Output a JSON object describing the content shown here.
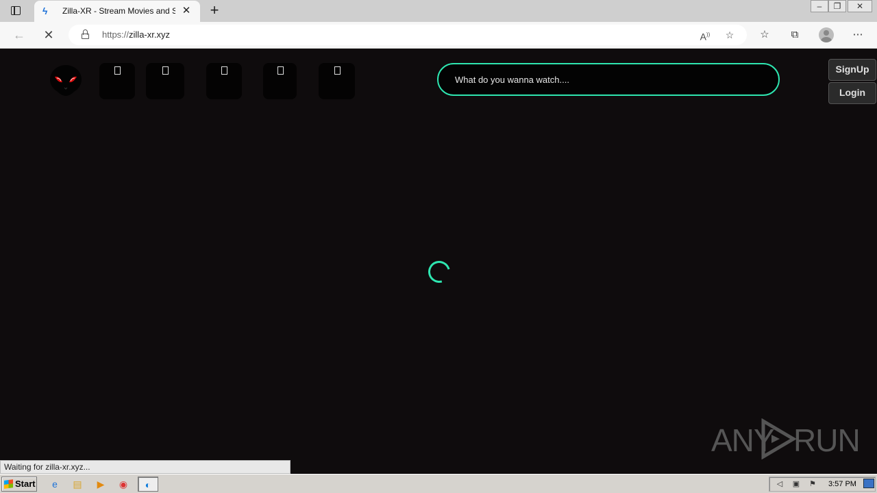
{
  "browser": {
    "tab_title": "Zilla-XR - Stream Movies and Se",
    "tab_favicon": "bird-favicon-icon",
    "close_tab": "✕",
    "new_tab": "+",
    "url_protocol": "https://",
    "url_host": "zilla-xr.xyz",
    "status_text": "Waiting for zilla-xr.xyz..."
  },
  "page": {
    "search_placeholder": "What do you wanna watch....",
    "signup_label": "SignUp",
    "login_label": "Login",
    "nav_tiles": [
      "tile-1",
      "tile-2",
      "tile-3",
      "tile-4",
      "tile-5"
    ],
    "accent_color": "#2ee6b0"
  },
  "watermark": {
    "left": "ANY",
    "right": "RUN"
  },
  "taskbar": {
    "start_label": "Start",
    "clock": "3:57 PM"
  }
}
